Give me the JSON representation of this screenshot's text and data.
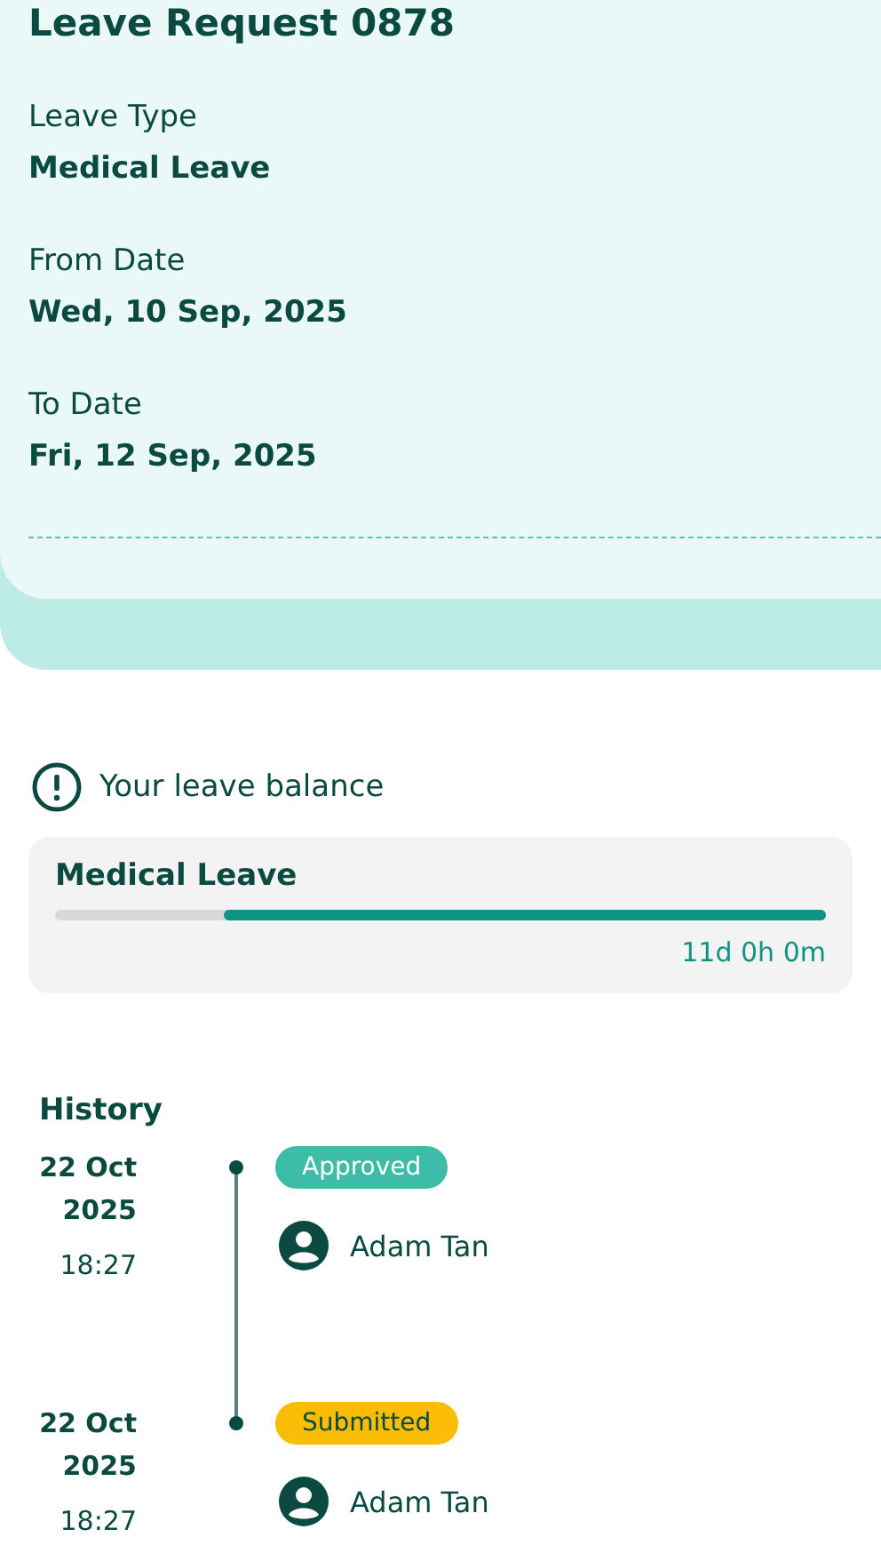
{
  "request": {
    "title": "Leave Request 0878",
    "fields": [
      {
        "label": "Leave Type",
        "value": "Medical Leave"
      },
      {
        "label": "From Date",
        "value": "Wed, 10 Sep, 2025"
      },
      {
        "label": "To Date",
        "value": "Fri, 12 Sep, 2025"
      }
    ]
  },
  "balance": {
    "heading": "Your leave balance",
    "items": [
      {
        "name": "Medical Leave",
        "level": 0.78,
        "reading": "11d 0h 0m"
      }
    ]
  },
  "history": {
    "title": "History",
    "entries": [
      {
        "date": "22 Oct",
        "year": "2025",
        "time": "18:27",
        "status": "Approved",
        "kind": "approved",
        "color": "#3dbca8",
        "person": "Adam Tan"
      },
      {
        "date": "22 Oct",
        "year": "2025",
        "time": "18:27",
        "status": "Submitted",
        "kind": "submitted",
        "color": "#fbbc05",
        "person": "Adam Tan"
      }
    ]
  }
}
